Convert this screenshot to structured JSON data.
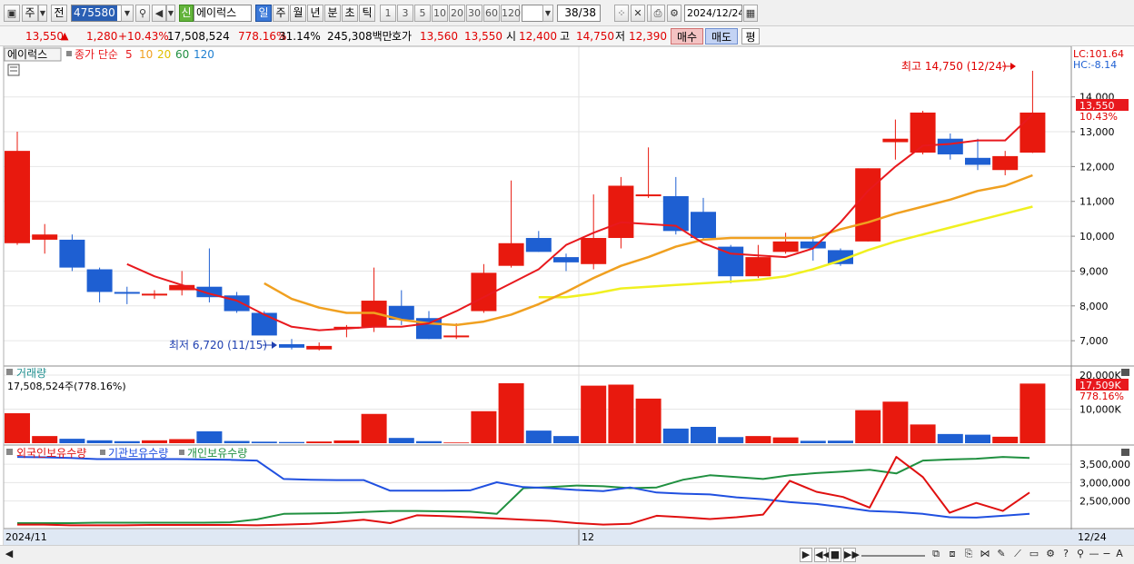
{
  "toolbar": {
    "market_label": "주",
    "prev_label": "전",
    "code": "475580",
    "new_badge": "신",
    "stock_name": "에이럭스",
    "periods": [
      "일",
      "주",
      "월",
      "년",
      "분",
      "초",
      "틱"
    ],
    "active_period": "일",
    "intervals": [
      "1",
      "3",
      "5",
      "10",
      "20",
      "30",
      "60",
      "120"
    ],
    "page_counter": "38/38",
    "date": "2024/12/24"
  },
  "quote": {
    "price": "13,550",
    "arrow": "▲",
    "change": "1,280",
    "change_pct": "+10.43%",
    "volume": "17,508,524",
    "volume_ratio": "778.16%",
    "turnover": "31.14%",
    "amount": "245,308백만",
    "hoga_label": "호가",
    "ask": "13,560",
    "bid": "13,550",
    "open_label": "시",
    "open": "12,400",
    "high_label": "고",
    "high": "14,750",
    "low_label": "저",
    "low": "12,390",
    "buy_label": "매수",
    "sell_label": "매도",
    "avg_label": "평"
  },
  "chart_labels": {
    "price_title": "에이럭스",
    "ma_prefix": "종가 단순",
    "ma_periods": [
      "5",
      "10",
      "20",
      "60",
      "120"
    ],
    "lc": "LC:101.64",
    "hc": "HC:-8.14",
    "high_note": "최고 14,750 (12/24)",
    "low_note": "최저 6,720 (11/15)",
    "last_price_tag": "13,550",
    "last_pct_tag": "10.43%",
    "volume_title": "거래량",
    "volume_info": "17,508,524주(778.16%)",
    "volume_tag": "17,509K",
    "volume_pct_tag": "778.16%",
    "holdings": [
      "외국인보유수량",
      "기관보유수량",
      "개인보유수량"
    ],
    "date_start": "2024/11",
    "date_mid": "12",
    "date_end": "12/24"
  },
  "colors": {
    "up": "#e8190e",
    "down": "#1e5fd2",
    "ma5": "#e8191e",
    "ma10": "#f0a020",
    "ma20": "#f0f020",
    "ma60": "#208f40",
    "ma120": "#1e7fd0",
    "foreign": "#e01010",
    "institution": "#2050e0",
    "individual": "#209040"
  },
  "chart_data": {
    "type": "candlestick",
    "price_axis": {
      "ticks": [
        "14,000",
        "13,000",
        "12,000",
        "11,000",
        "10,000",
        "9,000",
        "8,000",
        "7,000"
      ],
      "ylim": [
        6300,
        15400
      ]
    },
    "candles": [
      {
        "o": 9800,
        "h": 13000,
        "l": 9750,
        "c": 12450
      },
      {
        "o": 9900,
        "h": 10350,
        "l": 9500,
        "c": 10050
      },
      {
        "o": 9900,
        "h": 10050,
        "l": 9000,
        "c": 9100
      },
      {
        "o": 9050,
        "h": 9100,
        "l": 8100,
        "c": 8400
      },
      {
        "o": 8400,
        "h": 8550,
        "l": 8050,
        "c": 8350
      },
      {
        "o": 8300,
        "h": 8450,
        "l": 8200,
        "c": 8350
      },
      {
        "o": 8450,
        "h": 9000,
        "l": 8300,
        "c": 8600
      },
      {
        "o": 8550,
        "h": 9650,
        "l": 8100,
        "c": 8250
      },
      {
        "o": 8300,
        "h": 8400,
        "l": 7800,
        "c": 7850
      },
      {
        "o": 7800,
        "h": 7850,
        "l": 7200,
        "c": 7150
      },
      {
        "o": 6900,
        "h": 7050,
        "l": 6750,
        "c": 6800
      },
      {
        "o": 6750,
        "h": 6950,
        "l": 6720,
        "c": 6850
      },
      {
        "o": 7350,
        "h": 7450,
        "l": 7100,
        "c": 7400
      },
      {
        "o": 7400,
        "h": 9100,
        "l": 7250,
        "c": 8150
      },
      {
        "o": 8000,
        "h": 8450,
        "l": 7450,
        "c": 7600
      },
      {
        "o": 7650,
        "h": 7850,
        "l": 7050,
        "c": 7050
      },
      {
        "o": 7100,
        "h": 7500,
        "l": 7050,
        "c": 7150
      },
      {
        "o": 7850,
        "h": 9200,
        "l": 7800,
        "c": 8950
      },
      {
        "o": 9150,
        "h": 11600,
        "l": 9100,
        "c": 9800
      },
      {
        "o": 9950,
        "h": 10150,
        "l": 9550,
        "c": 9550
      },
      {
        "o": 9400,
        "h": 9500,
        "l": 9000,
        "c": 9250
      },
      {
        "o": 9200,
        "h": 11200,
        "l": 9050,
        "c": 9950
      },
      {
        "o": 9950,
        "h": 11700,
        "l": 9650,
        "c": 11450
      },
      {
        "o": 11150,
        "h": 12550,
        "l": 11100,
        "c": 11200
      },
      {
        "o": 11150,
        "h": 11700,
        "l": 10050,
        "c": 10150
      },
      {
        "o": 10700,
        "h": 11100,
        "l": 9900,
        "c": 9950
      },
      {
        "o": 9700,
        "h": 9750,
        "l": 8650,
        "c": 8850
      },
      {
        "o": 8850,
        "h": 9750,
        "l": 8800,
        "c": 9400
      },
      {
        "o": 9550,
        "h": 10100,
        "l": 9500,
        "c": 9850
      },
      {
        "o": 9850,
        "h": 10000,
        "l": 9300,
        "c": 9650
      },
      {
        "o": 9600,
        "h": 9650,
        "l": 9150,
        "c": 9200
      },
      {
        "o": 9850,
        "h": 11950,
        "l": 9850,
        "c": 11950
      },
      {
        "o": 12700,
        "h": 13350,
        "l": 12200,
        "c": 12800
      },
      {
        "o": 12400,
        "h": 13600,
        "l": 12350,
        "c": 13550
      },
      {
        "o": 12800,
        "h": 12950,
        "l": 12200,
        "c": 12350
      },
      {
        "o": 12250,
        "h": 12800,
        "l": 11900,
        "c": 12050
      },
      {
        "o": 11900,
        "h": 12450,
        "l": 11750,
        "c": 12300
      },
      {
        "o": 12400,
        "h": 14750,
        "l": 12390,
        "c": 13550
      }
    ],
    "ma5": [
      null,
      null,
      null,
      null,
      9200,
      8850,
      8600,
      8350,
      8150,
      7750,
      7400,
      7300,
      7350,
      7400,
      7400,
      7500,
      7850,
      8250,
      8650,
      9050,
      9750,
      10100,
      10400,
      10350,
      10300,
      9800,
      9500,
      9450,
      9400,
      9650,
      10400,
      11300,
      12000,
      12600,
      12650,
      12750,
      12750,
      13500
    ],
    "ma10": [
      null,
      null,
      null,
      null,
      null,
      null,
      null,
      null,
      null,
      8650,
      8200,
      7950,
      7800,
      7800,
      7600,
      7500,
      7450,
      7550,
      7750,
      8050,
      8400,
      8800,
      9150,
      9400,
      9700,
      9900,
      9950,
      9950,
      9950,
      9950,
      10200,
      10400,
      10650,
      10850,
      11050,
      11300,
      11450,
      11750
    ],
    "ma20": [
      null,
      null,
      null,
      null,
      null,
      null,
      null,
      null,
      null,
      null,
      null,
      null,
      null,
      null,
      null,
      null,
      null,
      null,
      null,
      8250,
      8250,
      8350,
      8500,
      8550,
      8600,
      8650,
      8700,
      8750,
      8850,
      9050,
      9300,
      9600,
      9850,
      10050,
      10250,
      10450,
      10650,
      10850
    ],
    "volume_axis": {
      "ticks": [
        "20,000K",
        "10,000K"
      ],
      "ylim": [
        0,
        20000
      ]
    },
    "volume": [
      8800,
      2100,
      1300,
      850,
      600,
      850,
      1200,
      3500,
      650,
      450,
      350,
      500,
      800,
      8600,
      1550,
      600,
      200,
      9400,
      17600,
      3700,
      2100,
      16900,
      17200,
      13100,
      4300,
      4800,
      1800,
      2100,
      1700,
      700,
      750,
      9700,
      12200,
      5500,
      2700,
      2500,
      1900,
      17509
    ],
    "holdings_axis": {
      "ticks": [
        "3,500,000",
        "3,000,000",
        "2,500,000"
      ],
      "ylim": [
        1800000,
        3800000
      ]
    },
    "foreign": [
      1860000,
      1860000,
      1840000,
      1840000,
      1840000,
      1850000,
      1850000,
      1850000,
      1850000,
      1840000,
      1860000,
      1880000,
      1930000,
      1990000,
      1900000,
      2110000,
      2090000,
      2060000,
      2030000,
      1990000,
      1960000,
      1900000,
      1860000,
      1880000,
      2100000,
      2060000,
      2010000,
      2060000,
      2130000,
      3050000,
      2750000,
      2610000,
      2320000,
      3700000,
      3150000,
      2180000,
      2450000,
      2230000,
      2730000
    ],
    "institution": [
      3700000,
      3690000,
      3670000,
      3640000,
      3640000,
      3640000,
      3640000,
      3630000,
      3620000,
      3600000,
      3100000,
      3080000,
      3070000,
      3070000,
      2780000,
      2780000,
      2780000,
      2790000,
      3010000,
      2880000,
      2850000,
      2800000,
      2770000,
      2870000,
      2730000,
      2700000,
      2680000,
      2600000,
      2550000,
      2470000,
      2420000,
      2330000,
      2230000,
      2200000,
      2150000,
      2060000,
      2050000,
      2100000,
      2150000
    ],
    "individual": [
      1900000,
      1900000,
      1900000,
      1910000,
      1910000,
      1910000,
      1910000,
      1910000,
      1920000,
      2000000,
      2150000,
      2160000,
      2170000,
      2200000,
      2230000,
      2230000,
      2220000,
      2210000,
      2150000,
      2850000,
      2880000,
      2920000,
      2900000,
      2850000,
      2870000,
      3080000,
      3200000,
      3150000,
      3100000,
      3200000,
      3260000,
      3300000,
      3350000,
      3250000,
      3600000,
      3630000,
      3650000,
      3700000,
      3670000
    ]
  }
}
